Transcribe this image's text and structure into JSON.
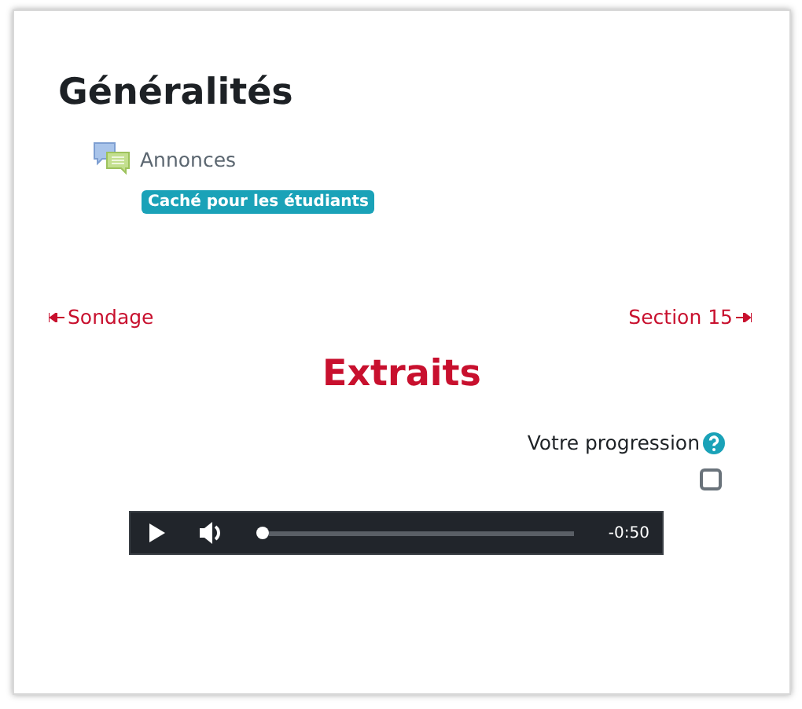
{
  "section": {
    "title": "Généralités",
    "activity": {
      "label": "Annonces",
      "badge": "Caché pour les étudiants"
    }
  },
  "navigation": {
    "previous": "Sondage",
    "next": "Section 15"
  },
  "heading": "Extraits",
  "progress": {
    "label": "Votre progression",
    "checked": false
  },
  "player": {
    "level": 0,
    "time": "-0:50"
  }
}
